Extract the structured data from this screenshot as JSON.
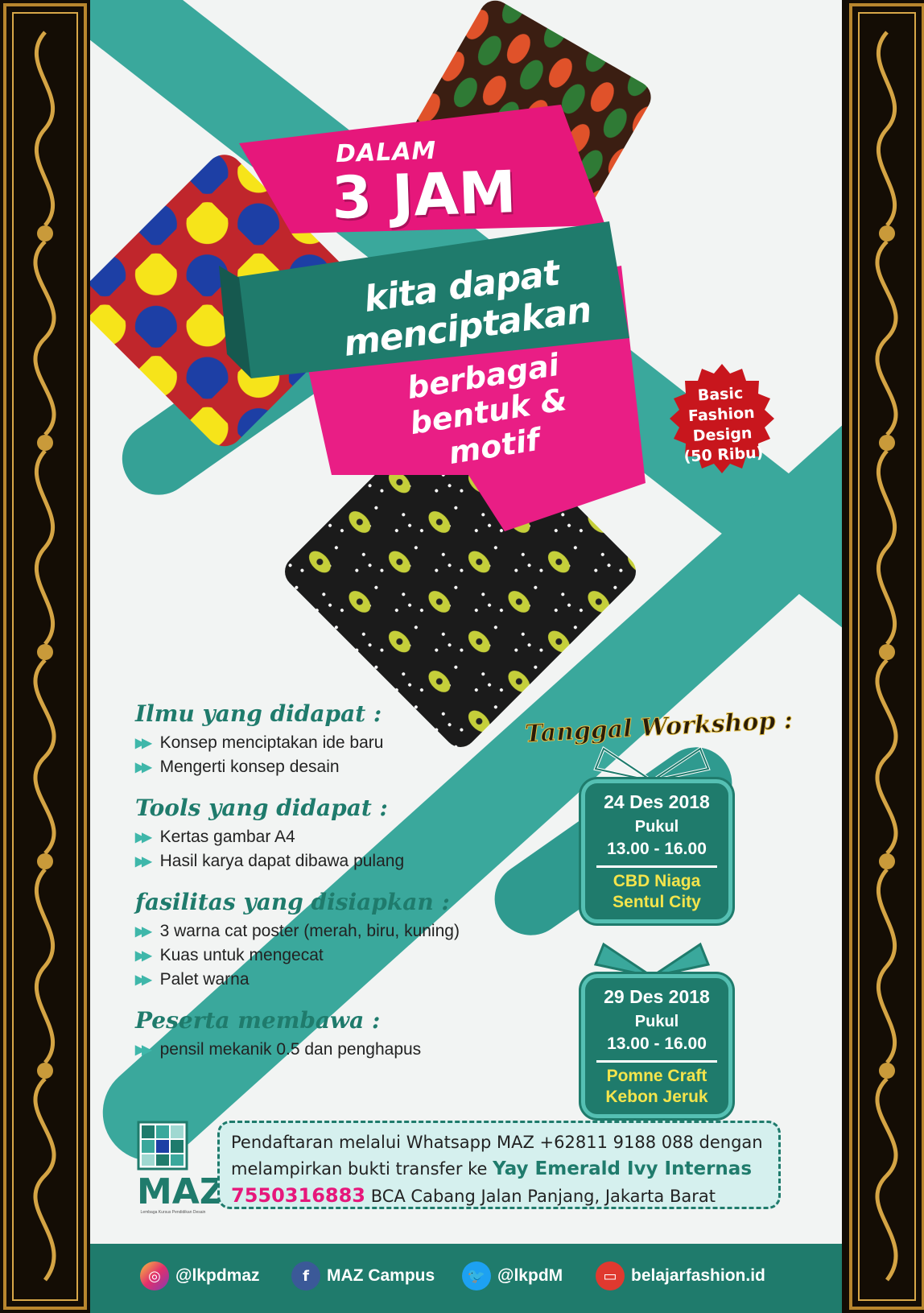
{
  "headline": {
    "line1": "DALAM",
    "line2": "3 JAM",
    "line3": "kita dapat menciptakan",
    "line4": "berbagai",
    "line5": "bentuk & motif"
  },
  "badge": {
    "line1": "Basic",
    "line2": "Fashion",
    "line3": "Design",
    "line4": "(50 Ribu)"
  },
  "sections": [
    {
      "title": "Ilmu yang didapat :",
      "items": [
        "Konsep menciptakan ide baru",
        "Mengerti konsep desain"
      ]
    },
    {
      "title": "Tools yang didapat :",
      "items": [
        "Kertas gambar A4",
        "Hasil karya dapat dibawa pulang"
      ]
    },
    {
      "title": "fasilitas yang disiapkan :",
      "items": [
        "3 warna cat poster (merah, biru, kuning)",
        "Kuas untuk mengecat",
        "Palet warna"
      ]
    },
    {
      "title": "Peserta  membawa :",
      "items": [
        "pensil mekanik 0.5 dan penghapus"
      ]
    }
  ],
  "workshop": {
    "heading": "Tanggal Workshop :",
    "sessions": [
      {
        "date": "24 Des 2018",
        "pukul": "Pukul",
        "time": "13.00 - 16.00",
        "place1": "CBD Niaga",
        "place2": "Sentul City"
      },
      {
        "date": "29 Des 2018",
        "pukul": "Pukul",
        "time": "13.00 - 16.00",
        "place1": "Pomne Craft",
        "place2": "Kebon Jeruk"
      }
    ]
  },
  "registration": {
    "line1": "Pendaftaran melalui Whatsapp MAZ +62811 9188 088 dengan",
    "line2_prefix": "melampirkan bukti transfer ke",
    "line2_highlight": "Yay Emerald Ivy Internas",
    "line3_account": "7550316883",
    "line3_suffix": "BCA Cabang Jalan Panjang, Jakarta Barat"
  },
  "logo": {
    "name": "MAZ",
    "tagline": "Lembaga Kursus Pendidikan Desain"
  },
  "footer": {
    "instagram": "@lkpdmaz",
    "facebook": "MAZ Campus",
    "twitter": "@lkpdM",
    "website": "belajarfashion.id"
  },
  "colors": {
    "teal": "#1f7b6c",
    "teal_light": "#3fb7aa",
    "pink": "#e6177b",
    "badge_red": "#c8161d",
    "gold": "#c99a3a"
  },
  "icons": [
    "instagram-icon",
    "facebook-icon",
    "twitter-icon",
    "web-icon",
    "double-arrow-icon"
  ]
}
